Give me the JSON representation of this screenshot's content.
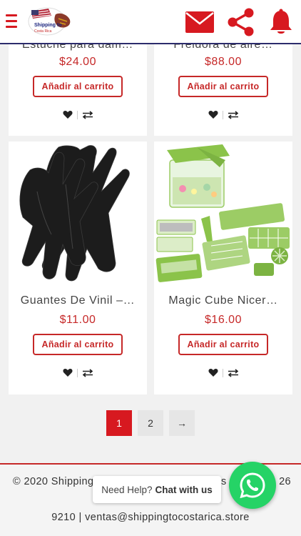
{
  "header": {
    "logo_text": "Shipping to Costa Rica",
    "icons": [
      "menu-icon",
      "mail-icon",
      "share-icon",
      "bell-icon"
    ],
    "accent": "#d71920"
  },
  "products": [
    {
      "name": "Estuche para dam…",
      "price": "$24.00",
      "cart_label": "Añadir al carrito"
    },
    {
      "name": "Freidora de aire…",
      "price": "$88.00",
      "cart_label": "Añadir al carrito"
    },
    {
      "name": "Guantes De Vinil –…",
      "price": "$11.00",
      "cart_label": "Añadir al carrito"
    },
    {
      "name": "Magic Cube Nicer…",
      "price": "$16.00",
      "cart_label": "Añadir al carrito"
    }
  ],
  "pagination": {
    "current": "1",
    "next_page": "2",
    "next_arrow": "→"
  },
  "footer": {
    "line1_left": "© 2020 Shipping",
    "line1_right_fragment": "s",
    "line1_end": "26",
    "line2": "9210 | ventas@shippingtocostarica.store"
  },
  "help_widget": {
    "prefix": "Need Help?",
    "bold": "Chat with us"
  },
  "colors": {
    "price": "#c62828",
    "whatsapp": "#25d366",
    "header_border": "#2c2c6c"
  }
}
